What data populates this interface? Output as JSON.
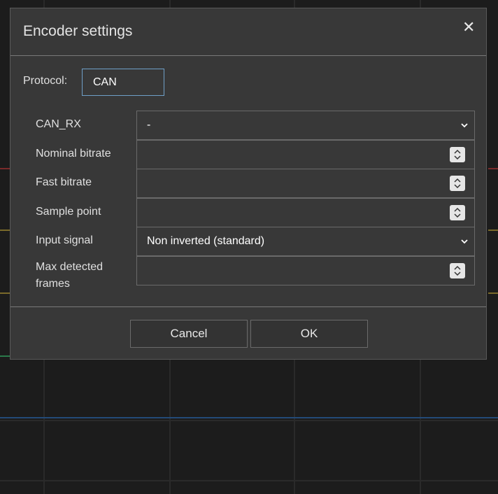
{
  "dialog": {
    "title": "Encoder settings",
    "close_icon": "close-icon",
    "protocol_label": "Protocol:",
    "protocol_value": "CAN",
    "fields": [
      {
        "label": "CAN_RX",
        "type": "select",
        "value": "-"
      },
      {
        "label": "Nominal bitrate",
        "type": "number",
        "value": ""
      },
      {
        "label": "Fast bitrate",
        "type": "number",
        "value": ""
      },
      {
        "label": "Sample point",
        "type": "number",
        "value": ""
      },
      {
        "label": "Input signal",
        "type": "select",
        "value": "Non inverted (standard)"
      },
      {
        "label": "Max detected frames",
        "type": "number",
        "value": ""
      }
    ],
    "cancel_label": "Cancel",
    "ok_label": "OK"
  },
  "colors": {
    "dialog_bg": "#383838",
    "page_bg": "#1c1c1c",
    "protocol_border": "#6fa0c8"
  }
}
